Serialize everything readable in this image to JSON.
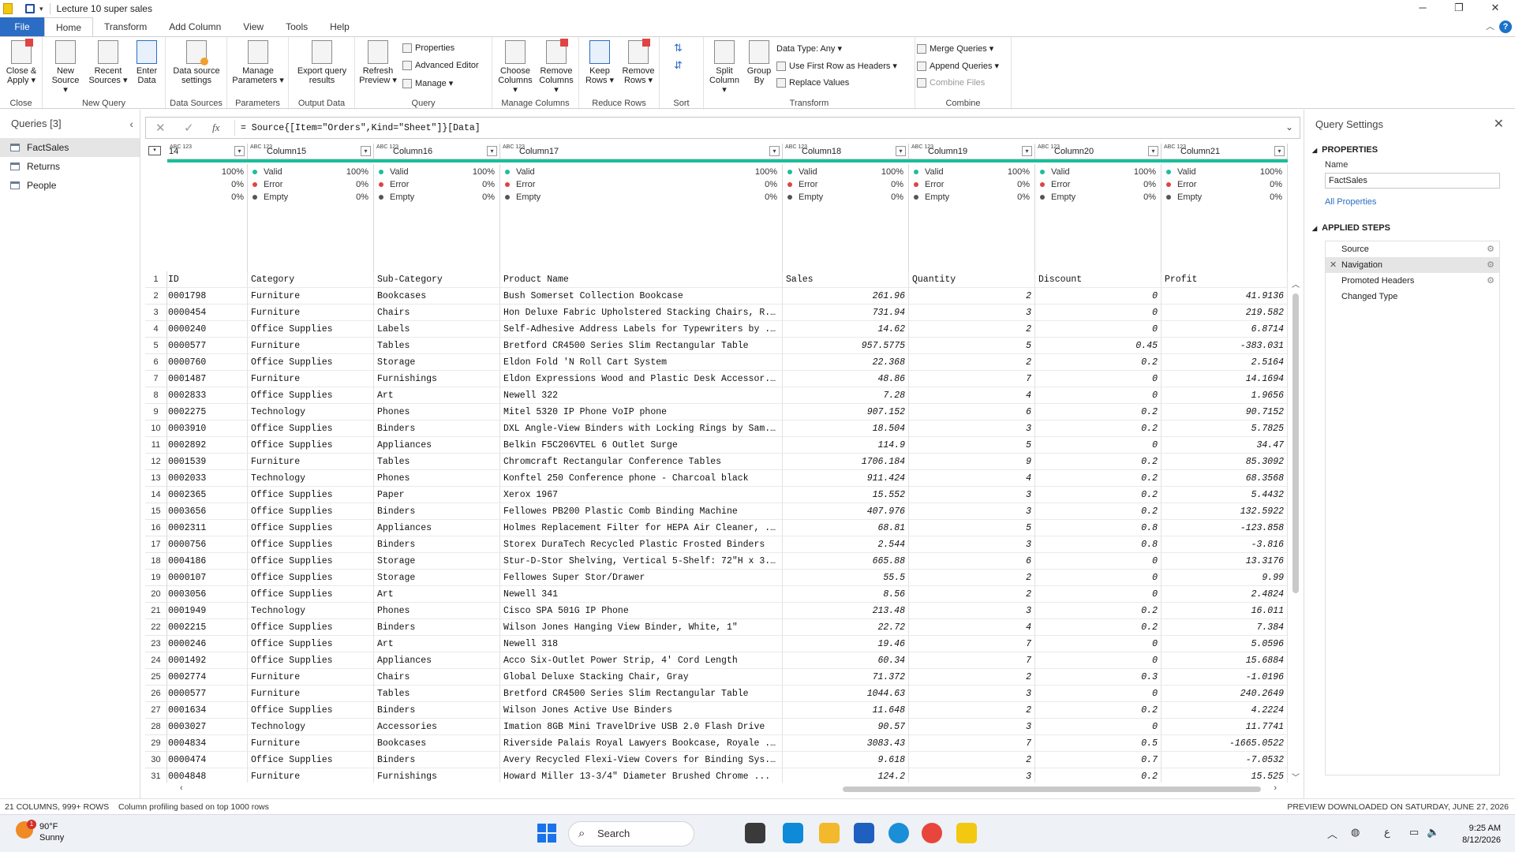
{
  "window": {
    "title": "Lecture 10 super sales"
  },
  "tabs": [
    "File",
    "Home",
    "Transform",
    "Add Column",
    "View",
    "Tools",
    "Help"
  ],
  "ribbon": {
    "close": {
      "label1": "Close &",
      "label2": "Apply ▾",
      "group": "Close"
    },
    "new_source": {
      "label1": "New",
      "label2": "Source ▾"
    },
    "recent_sources": {
      "label1": "Recent",
      "label2": "Sources ▾"
    },
    "enter_data": {
      "label1": "Enter",
      "label2": "Data"
    },
    "new_query_group": "New Query",
    "ds_settings": {
      "label1": "Data source",
      "label2": "settings",
      "group": "Data Sources"
    },
    "manage_params": {
      "label1": "Manage",
      "label2": "Parameters ▾",
      "group": "Parameters"
    },
    "export_query": {
      "label1": "Export query",
      "label2": "results",
      "group": "Output Data"
    },
    "refresh": {
      "label1": "Refresh",
      "label2": "Preview ▾"
    },
    "properties": "Properties",
    "advanced_editor": "Advanced Editor",
    "manage": "Manage ▾",
    "query_group": "Query",
    "choose_columns": {
      "label1": "Choose",
      "label2": "Columns ▾"
    },
    "remove_columns": {
      "label1": "Remove",
      "label2": "Columns ▾"
    },
    "manage_columns_group": "Manage Columns",
    "keep_rows": {
      "label1": "Keep",
      "label2": "Rows ▾"
    },
    "remove_rows": {
      "label1": "Remove",
      "label2": "Rows ▾"
    },
    "reduce_rows_group": "Reduce Rows",
    "sort_group": "Sort",
    "split_column": {
      "label1": "Split",
      "label2": "Column ▾"
    },
    "group_by": {
      "label1": "Group",
      "label2": "By"
    },
    "data_type": "Data Type: Any ▾",
    "use_first_row": "Use First Row as Headers ▾",
    "replace_values": "Replace Values",
    "transform_group": "Transform",
    "merge_queries": "Merge Queries ▾",
    "append_queries": "Append Queries ▾",
    "combine_files": "Combine Files",
    "combine_group": "Combine"
  },
  "queries": {
    "header": "Queries [3]",
    "items": [
      "FactSales",
      "Returns",
      "People"
    ]
  },
  "formula": {
    "text": "= Source{[Item=\"Orders\",Kind=\"Sheet\"]}[Data]"
  },
  "columns": [
    {
      "name": "14",
      "type": "ABC 123"
    },
    {
      "name": "Column15",
      "type": "ABC 123"
    },
    {
      "name": "Column16",
      "type": "ABC 123"
    },
    {
      "name": "Column17",
      "type": "ABC 123"
    },
    {
      "name": "Column18",
      "type": "ABC 123"
    },
    {
      "name": "Column19",
      "type": "ABC 123"
    },
    {
      "name": "Column20",
      "type": "ABC 123"
    },
    {
      "name": "Column21",
      "type": "ABC 123"
    }
  ],
  "profile": {
    "valid": "Valid",
    "error": "Error",
    "empty": "Empty",
    "valid_pct": "100%",
    "error_pct": "0%",
    "empty_pct": "0%"
  },
  "header_row": [
    "ID",
    "Category",
    "Sub-Category",
    "Product Name",
    "Sales",
    "Quantity",
    "Discount",
    "Profit"
  ],
  "rows": [
    [
      "0001798",
      "Furniture",
      "Bookcases",
      "Bush Somerset Collection Bookcase",
      "261.96",
      "2",
      "0",
      "41.9136"
    ],
    [
      "0000454",
      "Furniture",
      "Chairs",
      "Hon Deluxe Fabric Upholstered Stacking Chairs, R...",
      "731.94",
      "3",
      "0",
      "219.582"
    ],
    [
      "0000240",
      "Office Supplies",
      "Labels",
      "Self-Adhesive Address Labels for Typewriters by ...",
      "14.62",
      "2",
      "0",
      "6.8714"
    ],
    [
      "0000577",
      "Furniture",
      "Tables",
      "Bretford CR4500 Series Slim Rectangular Table",
      "957.5775",
      "5",
      "0.45",
      "-383.031"
    ],
    [
      "0000760",
      "Office Supplies",
      "Storage",
      "Eldon Fold 'N Roll Cart System",
      "22.368",
      "2",
      "0.2",
      "2.5164"
    ],
    [
      "0001487",
      "Furniture",
      "Furnishings",
      "Eldon Expressions Wood and Plastic Desk Accessor...",
      "48.86",
      "7",
      "0",
      "14.1694"
    ],
    [
      "0002833",
      "Office Supplies",
      "Art",
      "Newell 322",
      "7.28",
      "4",
      "0",
      "1.9656"
    ],
    [
      "0002275",
      "Technology",
      "Phones",
      "Mitel 5320 IP Phone VoIP phone",
      "907.152",
      "6",
      "0.2",
      "90.7152"
    ],
    [
      "0003910",
      "Office Supplies",
      "Binders",
      "DXL Angle-View Binders with Locking Rings by Sam...",
      "18.504",
      "3",
      "0.2",
      "5.7825"
    ],
    [
      "0002892",
      "Office Supplies",
      "Appliances",
      "Belkin F5C206VTEL 6 Outlet Surge",
      "114.9",
      "5",
      "0",
      "34.47"
    ],
    [
      "0001539",
      "Furniture",
      "Tables",
      "Chromcraft Rectangular Conference Tables",
      "1706.184",
      "9",
      "0.2",
      "85.3092"
    ],
    [
      "0002033",
      "Technology",
      "Phones",
      "Konftel 250 Conference phone - Charcoal black",
      "911.424",
      "4",
      "0.2",
      "68.3568"
    ],
    [
      "0002365",
      "Office Supplies",
      "Paper",
      "Xerox 1967",
      "15.552",
      "3",
      "0.2",
      "5.4432"
    ],
    [
      "0003656",
      "Office Supplies",
      "Binders",
      "Fellowes PB200 Plastic Comb Binding Machine",
      "407.976",
      "3",
      "0.2",
      "132.5922"
    ],
    [
      "0002311",
      "Office Supplies",
      "Appliances",
      "Holmes Replacement Filter for HEPA Air Cleaner, ...",
      "68.81",
      "5",
      "0.8",
      "-123.858"
    ],
    [
      "0000756",
      "Office Supplies",
      "Binders",
      "Storex DuraTech Recycled Plastic Frosted Binders",
      "2.544",
      "3",
      "0.8",
      "-3.816"
    ],
    [
      "0004186",
      "Office Supplies",
      "Storage",
      "Stur-D-Stor Shelving, Vertical 5-Shelf: 72\"H x 3...",
      "665.88",
      "6",
      "0",
      "13.3176"
    ],
    [
      "0000107",
      "Office Supplies",
      "Storage",
      "Fellowes Super Stor/Drawer",
      "55.5",
      "2",
      "0",
      "9.99"
    ],
    [
      "0003056",
      "Office Supplies",
      "Art",
      "Newell 341",
      "8.56",
      "2",
      "0",
      "2.4824"
    ],
    [
      "0001949",
      "Technology",
      "Phones",
      "Cisco SPA 501G IP Phone",
      "213.48",
      "3",
      "0.2",
      "16.011"
    ],
    [
      "0002215",
      "Office Supplies",
      "Binders",
      "Wilson Jones Hanging View Binder, White, 1\"",
      "22.72",
      "4",
      "0.2",
      "7.384"
    ],
    [
      "0000246",
      "Office Supplies",
      "Art",
      "Newell 318",
      "19.46",
      "7",
      "0",
      "5.0596"
    ],
    [
      "0001492",
      "Office Supplies",
      "Appliances",
      "Acco Six-Outlet Power Strip, 4' Cord Length",
      "60.34",
      "7",
      "0",
      "15.6884"
    ],
    [
      "0002774",
      "Furniture",
      "Chairs",
      "Global Deluxe Stacking Chair, Gray",
      "71.372",
      "2",
      "0.3",
      "-1.0196"
    ],
    [
      "0000577",
      "Furniture",
      "Tables",
      "Bretford CR4500 Series Slim Rectangular Table",
      "1044.63",
      "3",
      "0",
      "240.2649"
    ],
    [
      "0001634",
      "Office Supplies",
      "Binders",
      "Wilson Jones Active Use Binders",
      "11.648",
      "2",
      "0.2",
      "4.2224"
    ],
    [
      "0003027",
      "Technology",
      "Accessories",
      "Imation 8GB Mini TravelDrive USB 2.0 Flash Drive",
      "90.57",
      "3",
      "0",
      "11.7741"
    ],
    [
      "0004834",
      "Furniture",
      "Bookcases",
      "Riverside Palais Royal Lawyers Bookcase, Royale ...",
      "3083.43",
      "7",
      "0.5",
      "-1665.0522"
    ],
    [
      "0000474",
      "Office Supplies",
      "Binders",
      "Avery Recycled Flexi-View Covers for Binding Sys...",
      "9.618",
      "2",
      "0.7",
      "-7.0532"
    ],
    [
      "0004848",
      "Furniture",
      "Furnishings",
      "Howard Miller 13-3/4\" Diameter Brushed Chrome ...",
      "124.2",
      "3",
      "0.2",
      "15.525"
    ]
  ],
  "settings": {
    "title": "Query Settings",
    "properties": "PROPERTIES",
    "name_label": "Name",
    "name_value": "FactSales",
    "all_properties": "All Properties",
    "applied_steps": "APPLIED STEPS",
    "steps": [
      "Source",
      "Navigation",
      "Promoted Headers",
      "Changed Type"
    ]
  },
  "status": {
    "left": "21 COLUMNS, 999+ ROWS",
    "profiling": "Column profiling based on top 1000 rows",
    "right": "PREVIEW DOWNLOADED ON SATURDAY, JUNE 27, 2026"
  },
  "taskbar": {
    "temp": "90°F",
    "cond": "Sunny",
    "badge": "1",
    "search": "Search",
    "time": "9:25 AM",
    "date": "8/12/2026"
  },
  "colors": {
    "accent": "#2b6cc4",
    "quality": "#1cbe9c",
    "valid": "#1cbe9c",
    "error": "#e04343",
    "empty": "#555555"
  }
}
